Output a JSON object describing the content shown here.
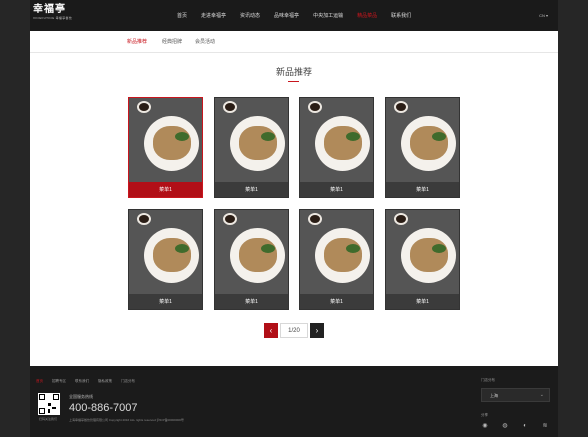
{
  "header": {
    "logo_main": "幸福亭",
    "logo_sub": "XINGFUTING 幸福亭餐饮",
    "nav": [
      "首页",
      "走进幸福亭",
      "资讯动态",
      "品味幸福亭",
      "中央加工运输",
      "精品菜品",
      "联系我们"
    ],
    "lang": "CN ▾"
  },
  "subnav": [
    "新品推荐",
    "经典招牌",
    "会员活动"
  ],
  "section_title": "新品推荐",
  "cards": [
    "菜单1",
    "菜单1",
    "菜单1",
    "菜单1",
    "菜单1",
    "菜单1",
    "菜单1",
    "菜单1"
  ],
  "pagination": {
    "prev": "‹",
    "info": "1/20",
    "next": "›"
  },
  "footer": {
    "links": [
      "首页",
      "招聘专区",
      "联系我们",
      "隐私政策",
      "门店分布"
    ],
    "qr_caption": "扫码关注我们",
    "hotline_label": "全国服务热线",
    "hotline": "400-886-7007",
    "copyright": "上海幸福亭餐饮管理有限公司 Copyright 2016 ALL rights reserved 沪ICP备00000000号",
    "store_label": "门店分布",
    "city": "上海",
    "share_label": "分享",
    "share_icons": [
      "◉",
      "◍",
      "◐",
      "≋"
    ]
  },
  "colors": {
    "accent": "#c8161e",
    "dark": "#1a1a1a"
  }
}
